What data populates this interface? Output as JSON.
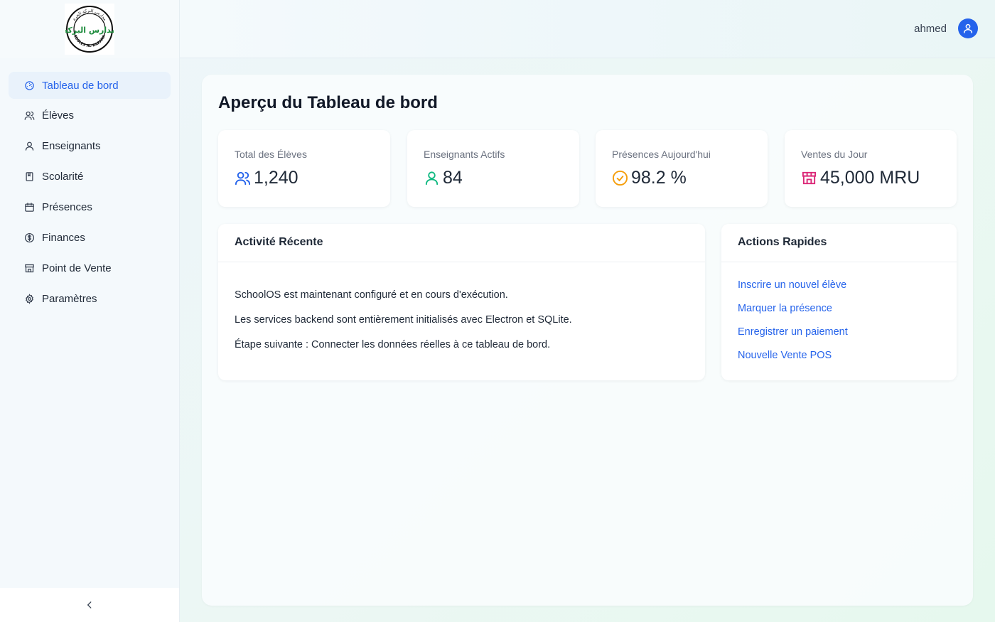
{
  "header": {
    "logo_text_arabic": "مدارس البركة",
    "logo_text_top": "مدارس البركة الحرة",
    "logo_text_bottom": "ECOLES AL-BARAKA",
    "user_name": "ahmed"
  },
  "sidebar": {
    "items": [
      {
        "label": "Tableau de bord",
        "icon": "dashboard-icon",
        "active": true
      },
      {
        "label": "Élèves",
        "icon": "students-icon",
        "active": false
      },
      {
        "label": "Enseignants",
        "icon": "teacher-icon",
        "active": false
      },
      {
        "label": "Scolarité",
        "icon": "book-icon",
        "active": false
      },
      {
        "label": "Présences",
        "icon": "calendar-icon",
        "active": false
      },
      {
        "label": "Finances",
        "icon": "dollar-circle-icon",
        "active": false
      },
      {
        "label": "Point de Vente",
        "icon": "store-icon",
        "active": false
      },
      {
        "label": "Paramètres",
        "icon": "gear-icon",
        "active": false
      }
    ],
    "collapse_icon": "chevron-left-icon"
  },
  "main": {
    "title": "Aperçu du Tableau de bord",
    "stats": [
      {
        "label": "Total des Élèves",
        "value": "1,240",
        "icon": "students-icon",
        "color": "#2563eb"
      },
      {
        "label": "Enseignants Actifs",
        "value": "84",
        "icon": "teacher-icon",
        "color": "#10b981"
      },
      {
        "label": "Présences Aujourd'hui",
        "value": "98.2 %",
        "icon": "check-circle-icon",
        "color": "#f59e0b"
      },
      {
        "label": "Ventes du Jour",
        "value": "45,000 MRU",
        "icon": "store-icon",
        "color": "#db2777"
      }
    ],
    "activity": {
      "title": "Activité Récente",
      "lines": [
        "SchoolOS est maintenant configuré et en cours d'exécution.",
        "Les services backend sont entièrement initialisés avec Electron et SQLite.",
        "Étape suivante : Connecter les données réelles à ce tableau de bord."
      ]
    },
    "actions": {
      "title": "Actions Rapides",
      "links": [
        "Inscrire un nouvel élève",
        "Marquer la présence",
        "Enregistrer un paiement",
        "Nouvelle Vente POS"
      ]
    }
  },
  "colors": {
    "accent": "#2563eb",
    "active_bg": "#e9f2fb"
  }
}
